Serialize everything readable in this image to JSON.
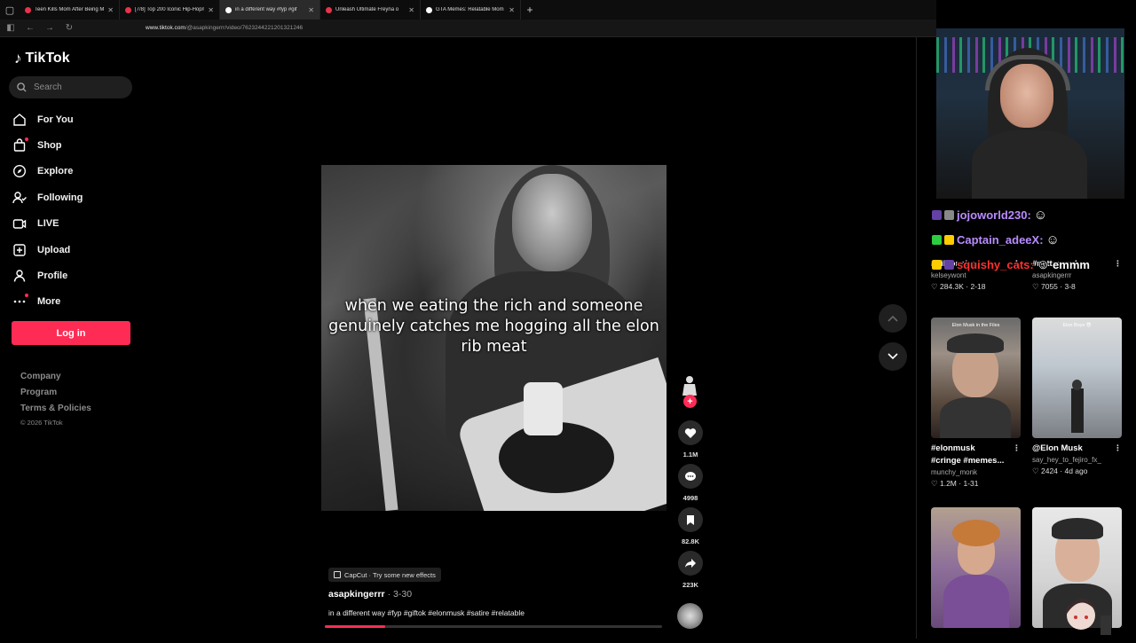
{
  "browser": {
    "tabs": [
      {
        "title": "Teen Kills Mom After Being Mi",
        "favicon": "youtube",
        "active": false
      },
      {
        "title": "[7/8] Top 200 Iconic Hip-Hop/R",
        "favicon": "youtube",
        "active": false
      },
      {
        "title": "in a different way #fyp #gif",
        "favicon": "tiktok",
        "active": true
      },
      {
        "title": "Unleash Ultimate Freyna o",
        "favicon": "youtube",
        "active": false
      },
      {
        "title": "GTA Memes: Relatable Mom",
        "favicon": "tiktok",
        "active": false
      }
    ],
    "url_host": "www.tiktok.com",
    "url_path": "/@asapkingerrr/video/7623244221201321246"
  },
  "sidebar": {
    "logo": "TikTok",
    "search_placeholder": "Search",
    "nav": [
      {
        "label": "For You",
        "icon": "home-icon"
      },
      {
        "label": "Shop",
        "icon": "shopping-bag-icon"
      },
      {
        "label": "Explore",
        "icon": "compass-icon"
      },
      {
        "label": "Following",
        "icon": "following-icon"
      },
      {
        "label": "LIVE",
        "icon": "live-icon"
      },
      {
        "label": "Upload",
        "icon": "upload-icon"
      },
      {
        "label": "Profile",
        "icon": "profile-icon"
      },
      {
        "label": "More",
        "icon": "more-icon"
      }
    ],
    "login_label": "Log in",
    "footer": [
      "Company",
      "Program",
      "Terms & Policies"
    ],
    "copyright": "© 2026 TikTok"
  },
  "video": {
    "caption": "when we eating the rich and someone genuinely catches me hogging all the elon rib meat",
    "effect_label": "CapCut · Try some new effects",
    "author": "asapkingerrr",
    "date": "· 3-30",
    "description": "in a different way #fyp #giftok #elonmusk #satire #relatable",
    "progress": 0.18,
    "likes": "1.1M",
    "comments": "4998",
    "saves": "82.8K",
    "shares": "223K"
  },
  "chat": [
    {
      "user": "jojoworld230:",
      "color": "#b98cff",
      "badge": "#6441a5"
    },
    {
      "user": "Captain_adeeX:",
      "color": "#b98cff",
      "badge": "#2ecc40"
    },
    {
      "user": "squishy_cats:",
      "color": "#ff3030",
      "badge": "#ffcc00",
      "message": "emmm"
    }
  ],
  "recommended": [
    {
      "title": "#billionaires...",
      "title2": "",
      "author": "kelseywont",
      "likes": "284.3K",
      "date": "2-18",
      "caption": ""
    },
    {
      "title": "#nettspend...",
      "title2": "",
      "author": "asapkingerrr",
      "likes": "7055",
      "date": "3-8",
      "caption": ""
    },
    {
      "title": "#elonmusk",
      "title2": "#cringe #memes...",
      "author": "munchy_monk",
      "likes": "1.2M",
      "date": "1-31",
      "caption": "Elon Musk in the Files"
    },
    {
      "title": "@Elon Musk",
      "title2": "",
      "author": "say_hey_to_fejiro_fx_",
      "likes": "2424",
      "date": "4d ago",
      "caption": "Elon Boys 😎"
    },
    {
      "title": "",
      "title2": "",
      "author": "",
      "likes": "",
      "date": "",
      "caption": ""
    },
    {
      "title": "",
      "title2": "",
      "author": "",
      "likes": "",
      "date": "",
      "caption": ""
    }
  ],
  "colors": {
    "accent": "#fe2c55",
    "background": "#000000"
  }
}
